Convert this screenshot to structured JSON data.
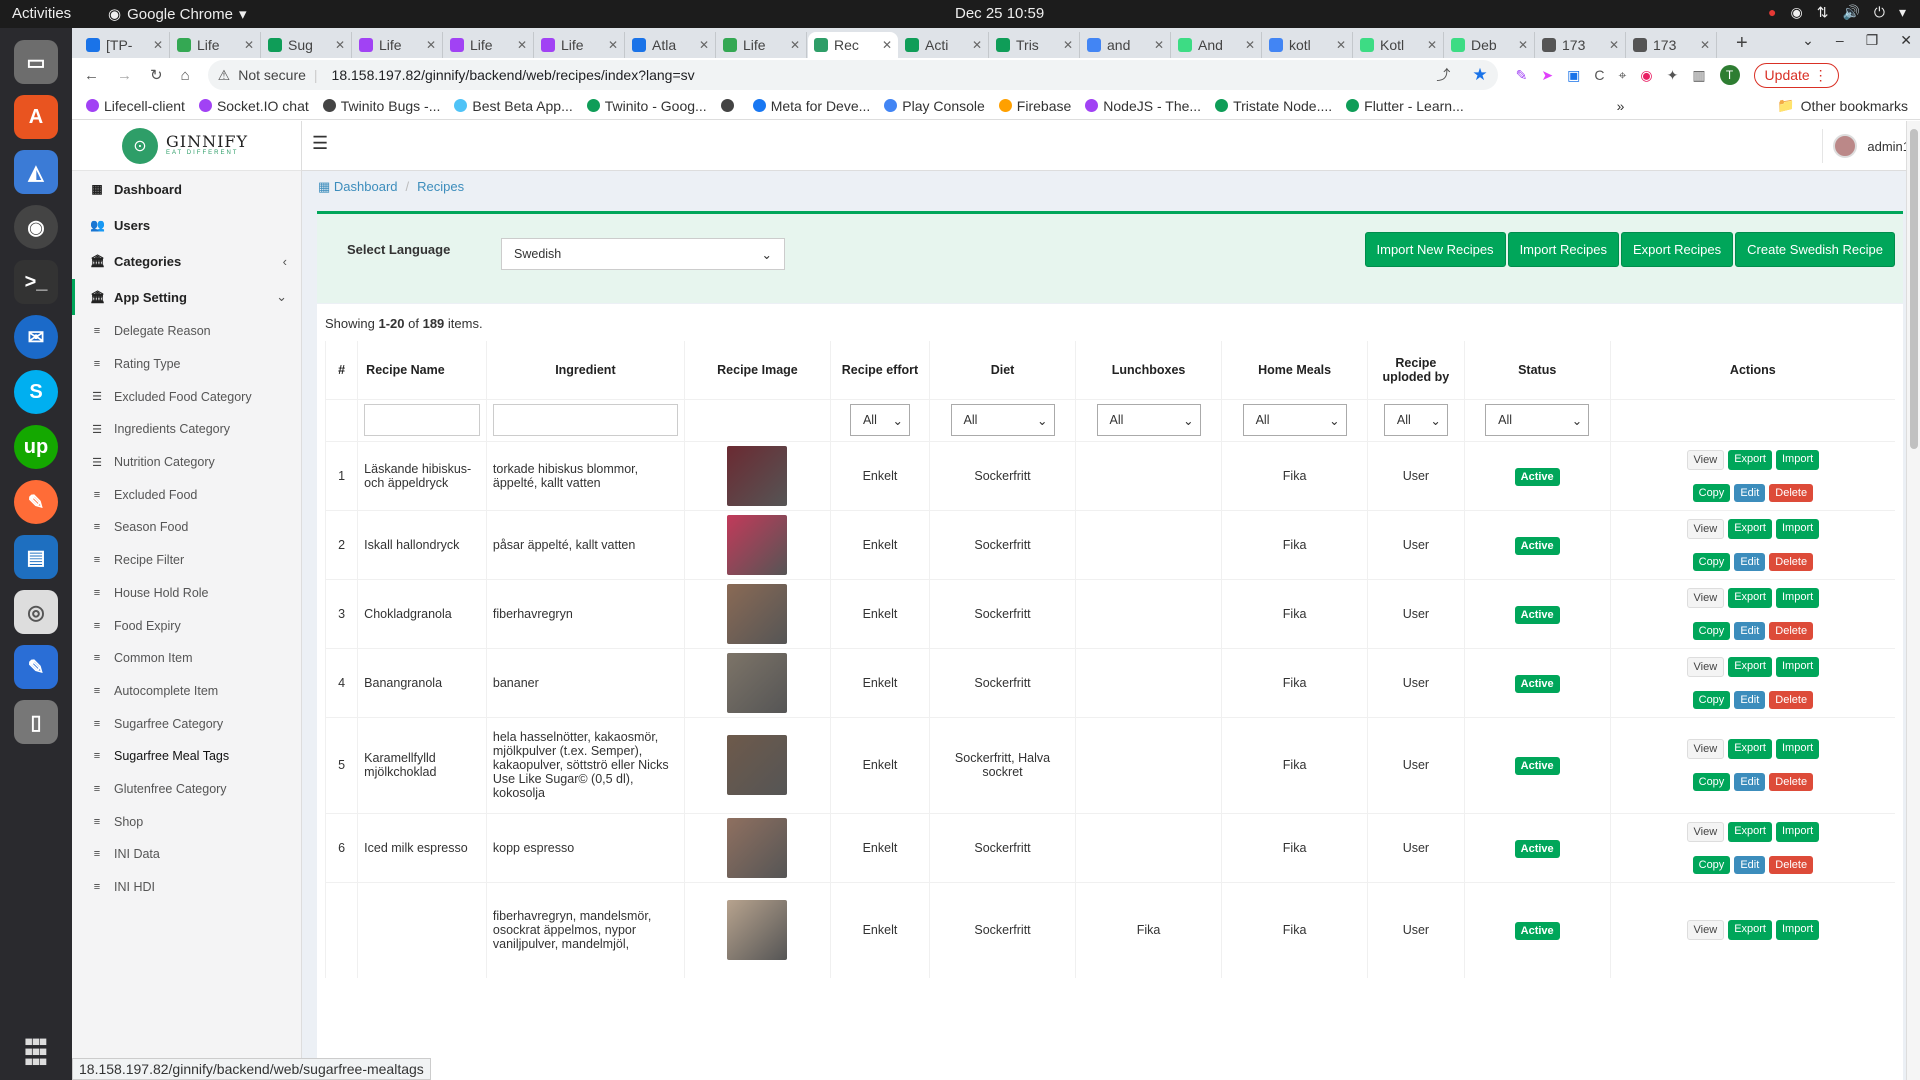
{
  "os": {
    "activities": "Activities",
    "app_name": "Google Chrome",
    "clock": "Dec 25  10:59"
  },
  "browser": {
    "tabs": [
      {
        "label": "[TP-",
        "color": "#1a73e8"
      },
      {
        "label": "Life",
        "color": "#34a853"
      },
      {
        "label": "Sug",
        "color": "#0f9d58"
      },
      {
        "label": "Life",
        "color": "#a142f4"
      },
      {
        "label": "Life",
        "color": "#a142f4"
      },
      {
        "label": "Life",
        "color": "#a142f4"
      },
      {
        "label": "Atla",
        "color": "#1a73e8"
      },
      {
        "label": "Life",
        "color": "#34a853"
      },
      {
        "label": "Rec",
        "color": "#2e9e68",
        "active": true
      },
      {
        "label": "Acti",
        "color": "#0f9d58"
      },
      {
        "label": "Tris",
        "color": "#0f9d58"
      },
      {
        "label": "and",
        "color": "#4285f4"
      },
      {
        "label": "And",
        "color": "#3ddc84"
      },
      {
        "label": "kotl",
        "color": "#4285f4"
      },
      {
        "label": "Kotl",
        "color": "#3ddc84"
      },
      {
        "label": "Deb",
        "color": "#3ddc84"
      },
      {
        "label": "173",
        "color": "#555"
      },
      {
        "label": "173",
        "color": "#555"
      }
    ],
    "not_secure": "Not secure",
    "url": "18.158.197.82/ginnify/backend/web/recipes/index?lang=sv",
    "update_label": "Update",
    "profile_initial": "T",
    "bookmarks": [
      {
        "label": "Lifecell-client",
        "color": "#a142f4"
      },
      {
        "label": "Socket.IO chat",
        "color": "#a142f4"
      },
      {
        "label": "Twinito Bugs -...",
        "color": "#444"
      },
      {
        "label": "Best Beta App...",
        "color": "#4fc3f7"
      },
      {
        "label": "Twinito - Goog...",
        "color": "#0f9d58"
      },
      {
        "label": "",
        "color": "#444"
      },
      {
        "label": "Meta for Deve...",
        "color": "#1877f2"
      },
      {
        "label": "Play Console",
        "color": "#4285f4"
      },
      {
        "label": "Firebase",
        "color": "#ffa000"
      },
      {
        "label": "NodeJS - The...",
        "color": "#a142f4"
      },
      {
        "label": "Tristate Node....",
        "color": "#0f9d58"
      },
      {
        "label": "Flutter - Learn...",
        "color": "#0f9d58"
      }
    ],
    "other_bookmarks": "Other bookmarks",
    "status_url": "18.158.197.82/ginnify/backend/web/sugarfree-mealtags"
  },
  "app": {
    "logo_title": "GINNIFY",
    "logo_sub": "EAT DIFFERENT",
    "user": "admin1",
    "nav": [
      {
        "label": "Dashboard",
        "icon": "dashboard-icon",
        "glyph": "▦"
      },
      {
        "label": "Users",
        "icon": "users-icon",
        "glyph": "👥"
      },
      {
        "label": "Categories",
        "icon": "categories-icon",
        "glyph": "🏛",
        "chevron": "‹"
      },
      {
        "label": "App Setting",
        "icon": "app-setting-icon",
        "glyph": "🏛",
        "chevron": "⌄"
      }
    ],
    "subnav": [
      {
        "label": "Delegate Reason",
        "glyph": "≡"
      },
      {
        "label": "Rating Type",
        "glyph": "≡"
      },
      {
        "label": "Excluded Food Category",
        "glyph": "☰"
      },
      {
        "label": "Ingredients Category",
        "glyph": "☰"
      },
      {
        "label": "Nutrition Category",
        "glyph": "☰"
      },
      {
        "label": "Excluded Food",
        "glyph": "≡"
      },
      {
        "label": "Season Food",
        "glyph": "≡"
      },
      {
        "label": "Recipe Filter",
        "glyph": "≡"
      },
      {
        "label": "House Hold Role",
        "glyph": "≡"
      },
      {
        "label": "Food Expiry",
        "glyph": "≡"
      },
      {
        "label": "Common Item",
        "glyph": "≡"
      },
      {
        "label": "Autocomplete Item",
        "glyph": "≡"
      },
      {
        "label": "Sugarfree Category",
        "glyph": "≡"
      },
      {
        "label": "Sugarfree Meal Tags",
        "glyph": "≡"
      },
      {
        "label": "Glutenfree Category",
        "glyph": "≡"
      },
      {
        "label": "Shop",
        "glyph": "≡"
      },
      {
        "label": "INI Data",
        "glyph": "≡"
      },
      {
        "label": "INI HDI",
        "glyph": "≡"
      }
    ],
    "breadcrumb": {
      "home": "Dashboard",
      "current": "Recipes"
    },
    "filter": {
      "label": "Select Language",
      "value": "Swedish",
      "buttons": [
        "Import New Recipes",
        "Import Recipes",
        "Export Recipes",
        "Create Swedish Recipe"
      ]
    },
    "summary": {
      "prefix": "Showing ",
      "range": "1-20",
      "mid": " of ",
      "total": "189",
      "suffix": " items."
    },
    "columns": [
      "#",
      "Recipe Name",
      "Ingredient",
      "Recipe Image",
      "Recipe effort",
      "Diet",
      "Lunchboxes",
      "Home Meals",
      "Recipe uploded by",
      "Status",
      "Actions"
    ],
    "filters": {
      "all": "All"
    },
    "action_labels": {
      "view": "View",
      "export": "Export",
      "import": "Import",
      "copy": "Copy",
      "edit": "Edit",
      "delete": "Delete"
    },
    "rows": [
      {
        "n": "1",
        "name": "Läskande hibiskus- och äppeldryck",
        "ingredient": "torkade hibiskus blommor, äppelté, kallt vatten",
        "effort": "Enkelt",
        "diet": "Sockerfritt",
        "lunch": "",
        "home": "Fika",
        "by": "User",
        "status": "Active",
        "img": "#6b2a32"
      },
      {
        "n": "2",
        "name": "Iskall hallondryck",
        "ingredient": "påsar äppelté, kallt vatten",
        "effort": "Enkelt",
        "diet": "Sockerfritt",
        "lunch": "",
        "home": "Fika",
        "by": "User",
        "status": "Active",
        "img": "#c23a5a"
      },
      {
        "n": "3",
        "name": "Chokladgranola",
        "ingredient": "fiberhavregryn",
        "effort": "Enkelt",
        "diet": "Sockerfritt",
        "lunch": "",
        "home": "Fika",
        "by": "User",
        "status": "Active",
        "img": "#8a6a55"
      },
      {
        "n": "4",
        "name": "Banangranola",
        "ingredient": "bananer",
        "effort": "Enkelt",
        "diet": "Sockerfritt",
        "lunch": "",
        "home": "Fika",
        "by": "User",
        "status": "Active",
        "img": "#7d7468"
      },
      {
        "n": "5",
        "name": "Karamellfylld mjölkchoklad",
        "ingredient": "hela hasselnötter, kakaosmör, mjölkpulver (t.ex. Semper), kakaopulver, söttströ eller Nicks Use Like Sugar© (0,5 dl), kokosolja",
        "effort": "Enkelt",
        "diet": "Sockerfritt, Halva sockret",
        "lunch": "",
        "home": "Fika",
        "by": "User",
        "status": "Active",
        "img": "#6e5a4b"
      },
      {
        "n": "6",
        "name": "Iced milk espresso",
        "ingredient": "kopp espresso",
        "effort": "Enkelt",
        "diet": "Sockerfritt",
        "lunch": "",
        "home": "Fika",
        "by": "User",
        "status": "Active",
        "img": "#8f7060"
      },
      {
        "n": "",
        "name": "",
        "ingredient": "fiberhavregryn, mandelsmör, osockrat äppelmos, nypor vaniljpulver, mandelmjöl,",
        "effort": "Enkelt",
        "diet": "Sockerfritt",
        "lunch": "Fika",
        "home": "Fika",
        "by": "User",
        "status": "Active",
        "img": "#b7a38e"
      }
    ]
  }
}
